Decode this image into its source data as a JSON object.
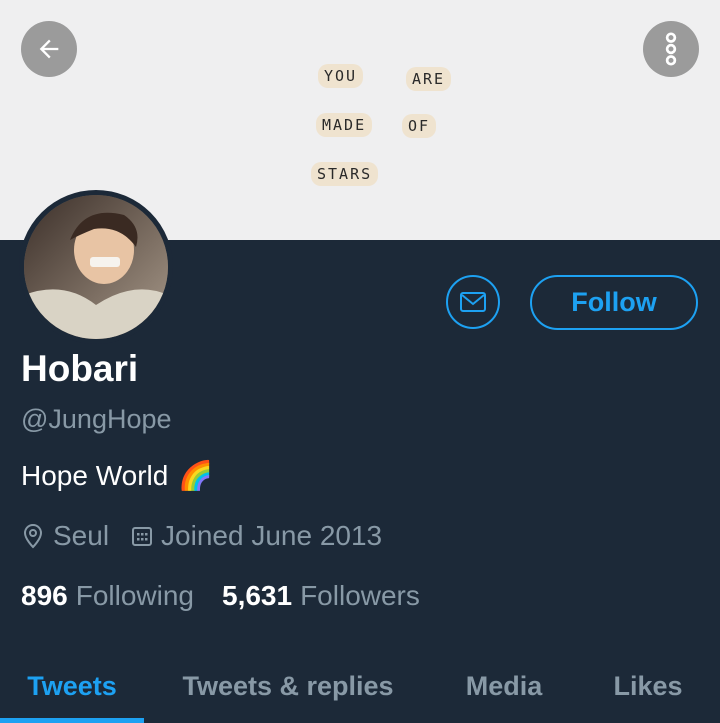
{
  "banner": {
    "words": [
      "YOU",
      "ARE",
      "MADE",
      "OF",
      "STARS"
    ]
  },
  "nav": {
    "back_icon": "arrow-left-icon",
    "more_icon": "more-vertical-icon"
  },
  "profile": {
    "name": "Hobari",
    "handle": "@JungHope",
    "bio": "Hope World",
    "bio_emoji": "🌈",
    "location": "Seul",
    "joined": "Joined June 2013",
    "following_count": "896",
    "following_label": "Following",
    "followers_count": "5,631",
    "followers_label": "Followers"
  },
  "actions": {
    "follow_label": "Follow",
    "message_icon": "envelope-icon"
  },
  "tabs": [
    {
      "label": "Tweets",
      "active": true
    },
    {
      "label": "Tweets & replies",
      "active": false
    },
    {
      "label": "Media",
      "active": false
    },
    {
      "label": "Likes",
      "active": false
    }
  ],
  "colors": {
    "background": "#1c2938",
    "accent": "#1da1f2",
    "muted": "#8899a6"
  }
}
